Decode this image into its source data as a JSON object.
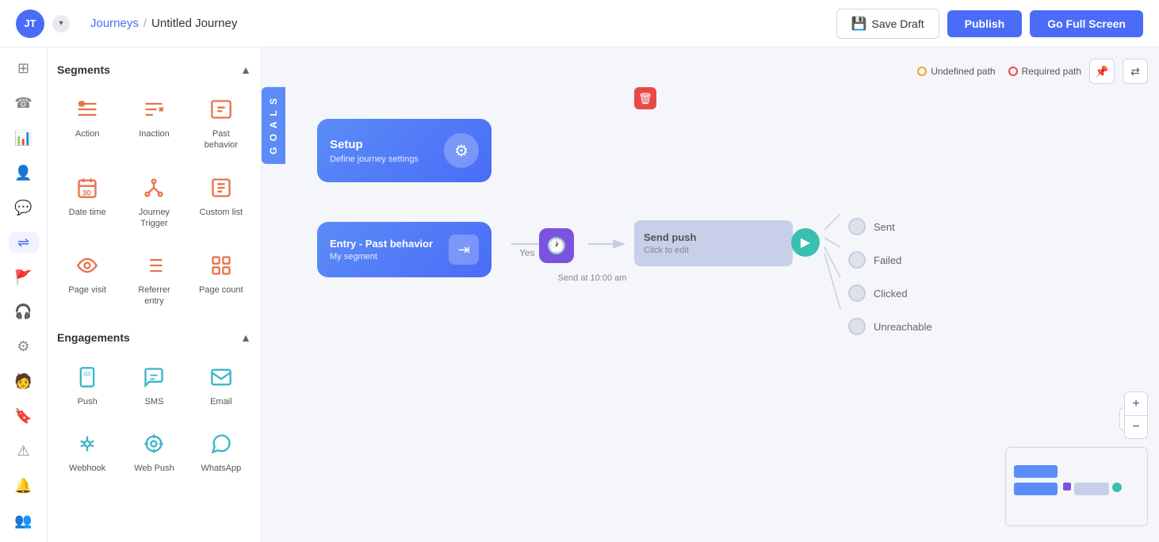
{
  "topbar": {
    "avatar_initials": "JT",
    "breadcrumb_link": "Journeys",
    "breadcrumb_sep": "/",
    "breadcrumb_current": "Untitled Journey",
    "save_draft_label": "Save Draft",
    "publish_label": "Publish",
    "fullscreen_label": "Go Full Screen"
  },
  "icon_nav": {
    "items": [
      {
        "id": "grid-icon",
        "symbol": "⊞",
        "active": false
      },
      {
        "id": "phone-icon",
        "symbol": "☎",
        "active": false
      },
      {
        "id": "chart-icon",
        "symbol": "📊",
        "active": false
      },
      {
        "id": "users-icon",
        "symbol": "👤",
        "active": false
      },
      {
        "id": "chat-icon",
        "symbol": "💬",
        "active": false
      },
      {
        "id": "journey-icon",
        "symbol": "⇌",
        "active": true
      },
      {
        "id": "flag-icon",
        "symbol": "🚩",
        "active": false
      },
      {
        "id": "headset-icon",
        "symbol": "🎧",
        "active": false
      },
      {
        "id": "settings-icon",
        "symbol": "⚙",
        "active": false
      },
      {
        "id": "person-icon",
        "symbol": "🧑",
        "active": false
      },
      {
        "id": "bookmark-icon",
        "symbol": "🔖",
        "active": false
      },
      {
        "id": "warning-icon",
        "symbol": "⚠",
        "active": false
      },
      {
        "id": "bell-icon",
        "symbol": "🔔",
        "active": false
      },
      {
        "id": "group-icon",
        "symbol": "👥",
        "active": false
      }
    ]
  },
  "sidebar": {
    "segments_title": "Segments",
    "segments_items": [
      {
        "id": "action",
        "label": "Action",
        "icon": "filter",
        "color": "orange"
      },
      {
        "id": "inaction",
        "label": "Inaction",
        "icon": "filter-x",
        "color": "orange"
      },
      {
        "id": "past-behavior",
        "label": "Past behavior",
        "icon": "history",
        "color": "orange"
      },
      {
        "id": "date-time",
        "label": "Date time",
        "icon": "calendar",
        "color": "orange"
      },
      {
        "id": "journey-trigger",
        "label": "Journey Trigger",
        "icon": "branch",
        "color": "orange"
      },
      {
        "id": "custom-list",
        "label": "Custom list",
        "icon": "list",
        "color": "orange"
      },
      {
        "id": "page-visit",
        "label": "Page visit",
        "icon": "eye",
        "color": "orange"
      },
      {
        "id": "referrer-entry",
        "label": "Referrer entry",
        "icon": "code",
        "color": "orange"
      },
      {
        "id": "page-count",
        "label": "Page count",
        "icon": "grid",
        "color": "orange"
      }
    ],
    "engagements_title": "Engagements",
    "engagements_items": [
      {
        "id": "push",
        "label": "Push",
        "icon": "push",
        "color": "teal"
      },
      {
        "id": "sms",
        "label": "SMS",
        "icon": "sms",
        "color": "teal"
      },
      {
        "id": "email",
        "label": "Email",
        "icon": "email",
        "color": "teal"
      },
      {
        "id": "webhook",
        "label": "Webhook",
        "icon": "webhook",
        "color": "teal"
      },
      {
        "id": "web-push",
        "label": "Web Push",
        "icon": "web-push",
        "color": "teal"
      },
      {
        "id": "whatsapp",
        "label": "WhatsApp",
        "icon": "whatsapp",
        "color": "teal"
      }
    ]
  },
  "canvas": {
    "goals_tab": "G\nO\nA\nL\nS",
    "undefined_path_label": "Undefined path",
    "required_path_label": "Required path",
    "setup_node": {
      "title": "Setup",
      "subtitle": "Define journey settings"
    },
    "entry_node": {
      "title": "Entry - Past behavior",
      "subtitle": "My segment"
    },
    "wait_node": {
      "send_time": "Send at 10:00 am"
    },
    "push_node": {
      "title": "Send push",
      "subtitle": "Click to edit"
    },
    "outcomes": [
      {
        "id": "sent",
        "label": "Sent"
      },
      {
        "id": "failed",
        "label": "Failed"
      },
      {
        "id": "clicked",
        "label": "Clicked"
      },
      {
        "id": "unreachable",
        "label": "Unreachable"
      }
    ],
    "yes_label": "Yes"
  }
}
